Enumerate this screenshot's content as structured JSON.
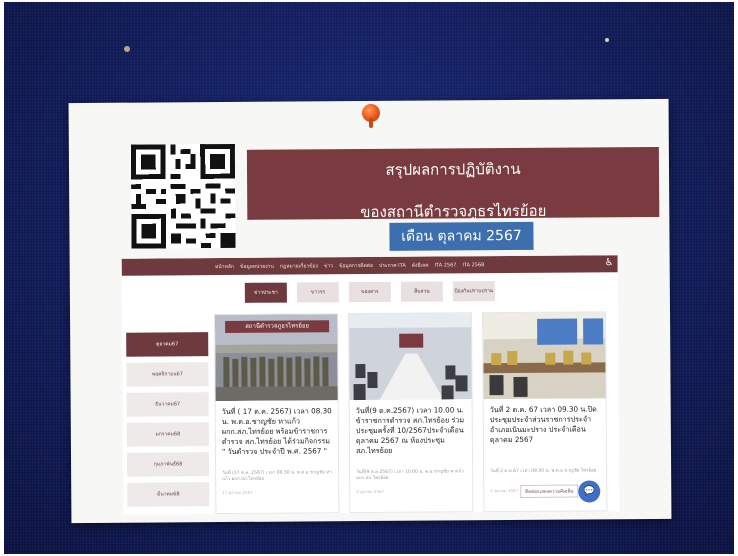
{
  "poster": {
    "title_line1": "สรุปผลการปฏิบัติงาน",
    "title_line2": "ของสถานีตำรวจภูธรไทรย้อย",
    "month_label": "เดือน ตุลาคม 2567"
  },
  "site": {
    "nav_items": [
      "หน้าหลัก",
      "ข้อมูลหน่วยงาน",
      "กฎหมายเกี่ยวข้อง",
      "ข่าว",
      "ข้อมูลการติดต่อ",
      "ประกาศ ITA",
      "ดังอีเลค",
      "ITA 2567",
      "ITA 2568"
    ],
    "tabs": [
      "ข่าวประชา",
      "ขาวรร",
      "ของสาร",
      "สืบสวน",
      "ป้องกันปราบปราม"
    ],
    "side_items": [
      "ตุลาคม67",
      "พฤศจิกายน67",
      "ธันวาคม67",
      "มกราคม68",
      "กุมภาพันธ์68",
      "มีนาคม68"
    ],
    "cards": [
      {
        "photo_banner": "สถานีตำรวจภูธรไทรย้อย",
        "headline": "วันที่ ( 17 ต.ค. 2567) เวลา 08.30 น. พ.ต.อ.ชาญชัย หาแก้ว ผกก.สภ.ไทรย้อย พร้อมข้าราชการตำรวจ สภ.ไทรย้อย ได้ร่วมกิจกรรม \" วันตำรวจ ประจำปี พ.ศ. 2567 \"",
        "excerpt": "วันที่ (17 ต.ค. 2567) เวลา 08.30 น. พ.ต.อ.ชาญชัย หาแก้ว ผกก.สภ.ไทรย้อย",
        "date": "17 ตุลาคม 2567"
      },
      {
        "headline": "วันที่(9 ต.ค.2567) เวลา 10.00 น. ข้าราชการตำรวจ สภ.ไทรย้อย ร่วมประชุมครั้งที่ 10/2567ประจำเดือน ตุลาคม 2567 ณ ห้องประชุม สภ.ไทรย้อย",
        "excerpt": "วันที่(9 ต.ค.2567) เวลา 10.00 น. ต.อ.ชาญชัย หาแก้ว ผกก.สภ.ไทรย้อย",
        "date": "9 ตุลาคม 2567"
      },
      {
        "headline": "วันที่ 2 ต.ค. 67 เวลา 09.30 น.ปิด ประชุมประจำส่วนราชการประจำ อำเภอเนินมะปราง ประจำเดือน ตุลาคม 2567",
        "excerpt": "วันที่ 2 ต.ค.67 เวลา 09.30 น. พ.ต.อ.ชาญชัย ไทรย้อย",
        "date": "2 ตุลาคม 2567",
        "read_more": "ติดต่อ/แสดงความคิดเห็น"
      }
    ]
  }
}
